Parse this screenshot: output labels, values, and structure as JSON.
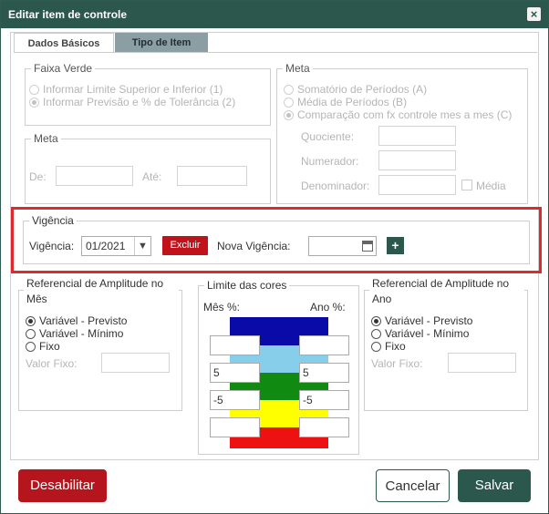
{
  "dialog": {
    "title": "Editar item de controle",
    "close_glyph": "×"
  },
  "tabs": [
    {
      "label": "Dados Básicos"
    },
    {
      "label": "Tipo de Item"
    }
  ],
  "faixa_verde": {
    "legend": "Faixa Verde",
    "options": [
      "Informar Limite Superior e Inferior (1)",
      "Informar Previsão e % de Tolerância (2)"
    ]
  },
  "meta_top": {
    "legend": "Meta",
    "options": [
      "Somatório de Períodos (A)",
      "Média de Períodos (B)",
      "Comparação com fx controle mes a mes (C)"
    ],
    "quociente_label": "Quociente:",
    "numerador_label": "Numerador:",
    "denominador_label": "Denominador:",
    "media_label": "Média"
  },
  "meta_left": {
    "legend": "Meta",
    "de_label": "De:",
    "ate_label": "Até:"
  },
  "vigencia": {
    "legend": "Vigência",
    "label": "Vigência:",
    "selected": "01/2021",
    "excluir_label": "Excluir",
    "nova_label": "Nova Vigência:",
    "plus": "+"
  },
  "ref_mes": {
    "title_line1": "Referencial de Amplitude no",
    "title_line2": "Mês",
    "options": [
      "Variável - Previsto",
      "Variável - Mínimo",
      "Fixo"
    ],
    "valor_fixo_label": "Valor Fixo:"
  },
  "limite_cores": {
    "legend": "Limite das cores",
    "mes_label": "Mês %:",
    "ano_label": "Ano %:",
    "mes_values": [
      "",
      "5",
      "-5",
      ""
    ],
    "ano_values": [
      "",
      "5",
      "-5",
      ""
    ],
    "band_colors": [
      "#0a0aa8",
      "#87ceeb",
      "#118a11",
      "#ffff00",
      "#ee1111"
    ]
  },
  "ref_ano": {
    "title_line1": "Referencial de Amplitude no",
    "title_line2": "Ano",
    "options": [
      "Variável - Previsto",
      "Variável - Mínimo",
      "Fixo"
    ],
    "valor_fixo_label": "Valor Fixo:"
  },
  "footer": {
    "disable_label": "Desabilitar",
    "cancel_label": "Cancelar",
    "save_label": "Salvar"
  },
  "colors": {
    "accent": "#2b574d",
    "danger": "#c1121c",
    "highlight_border": "#e0282f"
  }
}
